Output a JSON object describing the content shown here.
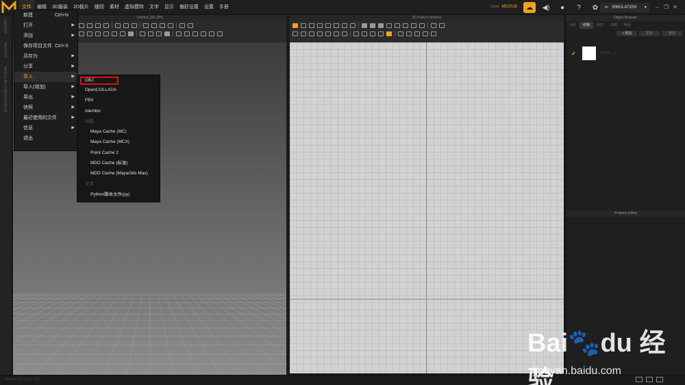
{
  "app": {
    "logo_letter": "M"
  },
  "menubar": {
    "items": [
      "文件",
      "编辑",
      "3D服装",
      "2D板片",
      "缝纫",
      "素材",
      "虚拟模特",
      "文字",
      "显示",
      "偏好设置",
      "设置",
      "手册"
    ]
  },
  "user": {
    "label": "User",
    "name": "MD2018"
  },
  "simulation": {
    "label": "SIMULATION"
  },
  "left_strip": {
    "labels": [
      "LIBRARY",
      "HISTORY",
      "MODULAR CONFIGURATOR"
    ]
  },
  "viewport3d": {
    "title": "Untitled_MD.ZPrj"
  },
  "pattern2d": {
    "title": "2D Pattern Window"
  },
  "object_browser": {
    "title": "Object Browser",
    "tabs": [
      "场景",
      "织物",
      "纽扣",
      "扣眼",
      "明线"
    ],
    "active_tab": "织物",
    "buttons": {
      "add": "+ 增加",
      "copy": "复制",
      "delete": "删除"
    },
    "item_name": "FABRIC_1"
  },
  "property_editor": {
    "title": "Property Editor"
  },
  "status": {
    "version": "Version: 4.2.241.0 (R0)"
  },
  "file_menu": {
    "items": [
      {
        "label": "新建",
        "shortcut": "Ctrl+N",
        "arrow": ""
      },
      {
        "label": "打开",
        "shortcut": "",
        "arrow": "▶"
      },
      {
        "label": "添加",
        "shortcut": "",
        "arrow": "▶"
      },
      {
        "label": "保存项目文件",
        "shortcut": "Ctrl+S",
        "arrow": ""
      },
      {
        "label": "另存为",
        "shortcut": "",
        "arrow": "▶"
      },
      {
        "label": "分享",
        "shortcut": "",
        "arrow": "▶"
      },
      {
        "label": "导入",
        "shortcut": "",
        "arrow": "▶"
      },
      {
        "label": "导入(增加)",
        "shortcut": "",
        "arrow": "▶"
      },
      {
        "label": "导出",
        "shortcut": "",
        "arrow": "▶"
      },
      {
        "label": "快照",
        "shortcut": "",
        "arrow": "▶"
      },
      {
        "label": "最近使用的文件",
        "shortcut": "",
        "arrow": "▶"
      },
      {
        "label": "信息",
        "shortcut": "",
        "arrow": "▶"
      },
      {
        "label": "退出",
        "shortcut": "",
        "arrow": ""
      }
    ]
  },
  "import_menu": {
    "obj": "OBJ",
    "items": [
      "OpenCOLLADA",
      "FBX",
      "Alembic"
    ],
    "animation_header": "动画",
    "animation_items": [
      "Maya Cache (MC)",
      "Maya Cache (MCX)",
      "Point Cache 2",
      "MDD Cache (标准)",
      "MDD Cache (Maya/3ds Max)"
    ],
    "text_header": "文字",
    "text_items": [
      "Python脚本文件(py)"
    ]
  },
  "watermark": {
    "brand": "Bai",
    "brand_tail": "经验",
    "url": "jingyan.baidu.com"
  },
  "colors": {
    "accent": "#f3a41b",
    "highlight_box": "#e01010"
  }
}
